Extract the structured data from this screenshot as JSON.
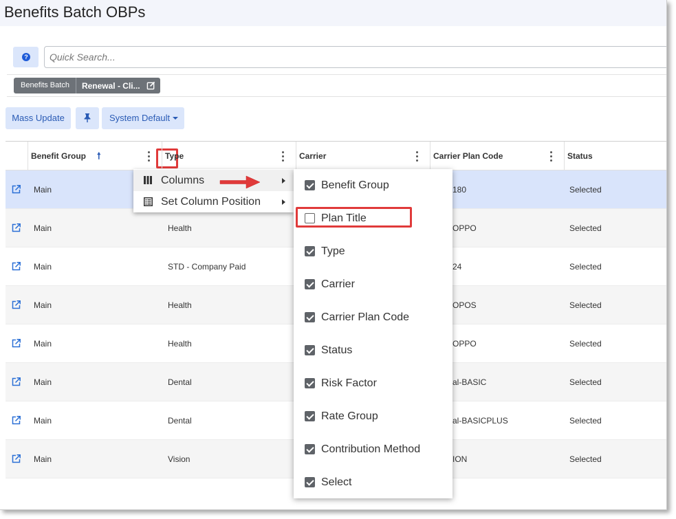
{
  "page": {
    "title": "Benefits Batch OBPs"
  },
  "search": {
    "placeholder": "Quick Search..."
  },
  "help": {
    "icon": "help-circle-icon",
    "glyph": "?"
  },
  "breadcrumb": {
    "chip1": "Benefits Batch",
    "chip2": "Renewal - Cli...",
    "chip2_icon": "edit-icon"
  },
  "toolbar": {
    "mass_update": "Mass Update",
    "pin_icon": "pin-icon",
    "view": "System Default"
  },
  "grid": {
    "columns": [
      "Benefit Group",
      "Type",
      "Carrier",
      "Carrier Plan Code",
      "Status"
    ],
    "sort": {
      "column": "Benefit Group",
      "direction": "ascending"
    },
    "rows": [
      {
        "group": "Main",
        "type": "",
        "plan_code": "180",
        "status": "Selected",
        "selected": true
      },
      {
        "group": "Main",
        "type": "Health",
        "plan_code": "OPPO",
        "status": "Selected"
      },
      {
        "group": "Main",
        "type": "STD - Company Paid",
        "plan_code": "24",
        "status": "Selected"
      },
      {
        "group": "Main",
        "type": "Health",
        "plan_code": "OPOS",
        "status": "Selected"
      },
      {
        "group": "Main",
        "type": "Health",
        "plan_code": "OPPO",
        "status": "Selected"
      },
      {
        "group": "Main",
        "type": "Dental",
        "plan_code": "al-BASIC",
        "status": "Selected"
      },
      {
        "group": "Main",
        "type": "Dental",
        "plan_code": "al-BASICPLUS",
        "status": "Selected"
      },
      {
        "group": "Main",
        "type": "Vision",
        "plan_code": "ION",
        "status": "Selected"
      }
    ]
  },
  "context_menu": {
    "columns": "Columns",
    "set_position": "Set Column Position"
  },
  "columns_submenu": [
    {
      "label": "Benefit Group",
      "checked": true
    },
    {
      "label": "Plan Title",
      "checked": false
    },
    {
      "label": "Type",
      "checked": true
    },
    {
      "label": "Carrier",
      "checked": true
    },
    {
      "label": "Carrier Plan Code",
      "checked": true
    },
    {
      "label": "Status",
      "checked": true
    },
    {
      "label": "Risk Factor",
      "checked": true
    },
    {
      "label": "Rate Group",
      "checked": true
    },
    {
      "label": "Contribution Method",
      "checked": true
    },
    {
      "label": "Select",
      "checked": true
    }
  ],
  "colors": {
    "accent": "#2a5bb5",
    "button_bg": "#dbe6fb",
    "selected_row": "#d9e4fb",
    "annotation_red": "#e03a3a"
  }
}
